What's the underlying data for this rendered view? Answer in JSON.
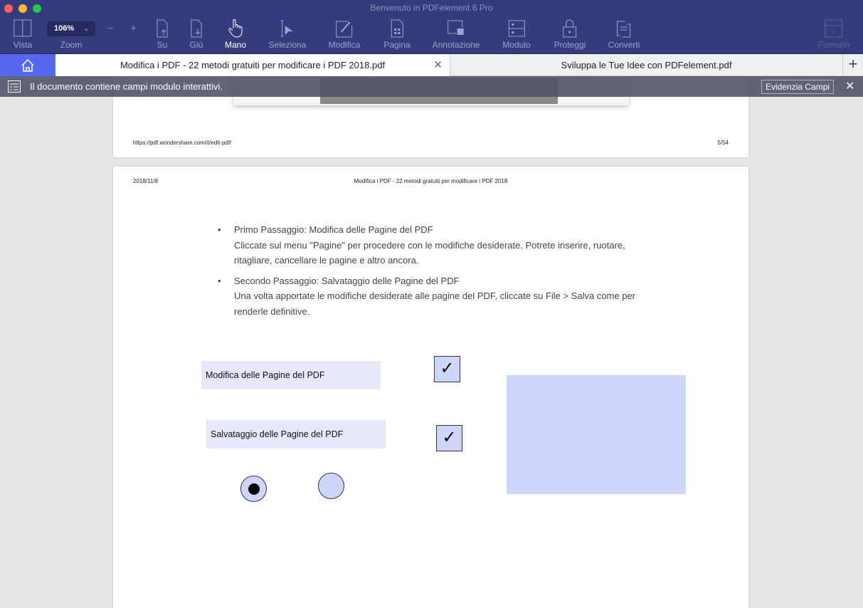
{
  "window": {
    "title": "Benvenuto in PDFelement 6 Pro"
  },
  "toolbar": {
    "vista": "Vista",
    "zoom_value": "106%",
    "zoom": "Zoom",
    "minus": "−",
    "plus": "+",
    "su": "Su",
    "giu": "Giù",
    "mano": "Mano",
    "seleziona": "Seleziona",
    "modifica": "Modifica",
    "pagina": "Pagina",
    "annotazione": "Annotazione",
    "modulo": "Modulo",
    "proteggi": "Proteggi",
    "converti": "Converti",
    "formato": "Formato"
  },
  "tabs": [
    {
      "label": "Modifica i PDF - 22 metodi gratuiti per modificare i PDF 2018.pdf",
      "active": true
    },
    {
      "label": "Sviluppa le Tue Idee con PDFelement.pdf",
      "active": false
    }
  ],
  "notice": {
    "text": "Il documento contiene campi modulo interattivi.",
    "button": "Evidenzia Campi",
    "close": "✕"
  },
  "page1": {
    "url": "https://pdf.wondershare.com/it/edit-pdf/",
    "page_num": "5/54"
  },
  "page2": {
    "date": "2018/11/8",
    "header": "Modifica i PDF - 22 metodi gratuiti per modificare i PDF 2018",
    "bullets": [
      {
        "title": "Primo Passaggio: Modifica delle Pagine del PDF",
        "text": "Cliccate sul menu \"Pagine\" per procedere con le modifiche desiderate. Potrete inserire, ruotare, ritagliare, cancellare le pagine e altro ancora."
      },
      {
        "title": "Secondo Passaggio: Salvataggio delle Pagine del PDF",
        "text": "Una volta apportate le modifiche desiderate alle pagine del PDF, cliccate su File > Salva come per renderle definitive."
      }
    ],
    "fields": [
      "Modifica delle Pagine del PDF",
      "Salvataggio delle Pagine del PDF"
    ],
    "checks": [
      "✓",
      "✓"
    ],
    "radio_selected": 0
  }
}
